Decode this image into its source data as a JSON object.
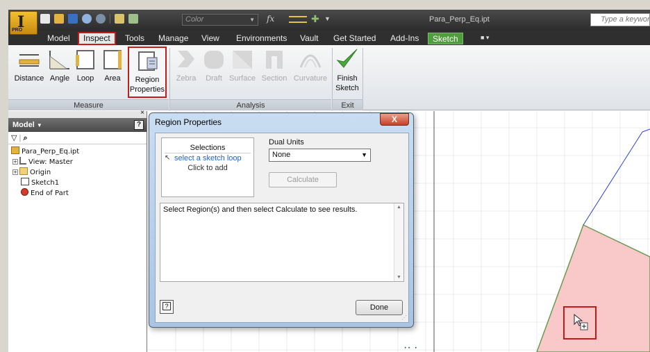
{
  "window": {
    "doc_title": "Para_Perp_Eq.ipt",
    "app_letter": "I",
    "app_badge": "PRO",
    "color_placeholder": "Color",
    "fx_label": "fx",
    "search_placeholder": "Type a keyword o"
  },
  "tabs": [
    {
      "label": "Model"
    },
    {
      "label": "Inspect"
    },
    {
      "label": "Tools"
    },
    {
      "label": "Manage"
    },
    {
      "label": "View"
    },
    {
      "label": "Environments"
    },
    {
      "label": "Vault"
    },
    {
      "label": "Get Started"
    },
    {
      "label": "Add-Ins"
    },
    {
      "label": "Sketch"
    }
  ],
  "ribbon": {
    "measure": {
      "label": "Measure",
      "buttons": [
        {
          "label": "Distance",
          "icon": "distance-icon"
        },
        {
          "label": "Angle",
          "icon": "angle-icon"
        },
        {
          "label": "Loop",
          "icon": "loop-icon"
        },
        {
          "label": "Area",
          "icon": "area-icon"
        },
        {
          "label": "Region\nProperties",
          "icon": "region-properties-icon"
        }
      ]
    },
    "analysis": {
      "label": "Analysis",
      "buttons": [
        {
          "label": "Zebra",
          "icon": "zebra-icon"
        },
        {
          "label": "Draft",
          "icon": "draft-icon"
        },
        {
          "label": "Surface",
          "icon": "surface-icon"
        },
        {
          "label": "Section",
          "icon": "section-icon"
        },
        {
          "label": "Curvature",
          "icon": "curvature-icon"
        }
      ]
    },
    "exit": {
      "label": "Exit",
      "finish_label": "Finish\nSketch",
      "icon": "checkmark-icon"
    }
  },
  "browser": {
    "title": "Model",
    "close": "×",
    "help": "?",
    "tools": "▽ | 🔍",
    "tree": [
      {
        "label": "Para_Perp_Eq.ipt",
        "icon": "part-icon"
      },
      {
        "label": "View: Master",
        "icon": "view-icon"
      },
      {
        "label": "Origin",
        "icon": "folder-icon"
      },
      {
        "label": "Sketch1",
        "icon": "sketch-icon"
      },
      {
        "label": "End of Part",
        "icon": "end-of-part-icon"
      }
    ]
  },
  "dialog": {
    "title": "Region Properties",
    "close": "X",
    "selections_header": "Selections",
    "selection_link": "select a sketch loop",
    "selection_hint": "Click to add",
    "dual_units_label": "Dual Units",
    "dual_units_value": "None",
    "calculate_label": "Calculate",
    "results_text": "Select Region(s) and then select Calculate to see results.",
    "help": "?",
    "done_label": "Done"
  },
  "colors": {
    "highlight": "#c41a1a",
    "region_fill": "#f9c9c9",
    "sketch_tab": "#4f9d3c",
    "link": "#1e64c8"
  }
}
